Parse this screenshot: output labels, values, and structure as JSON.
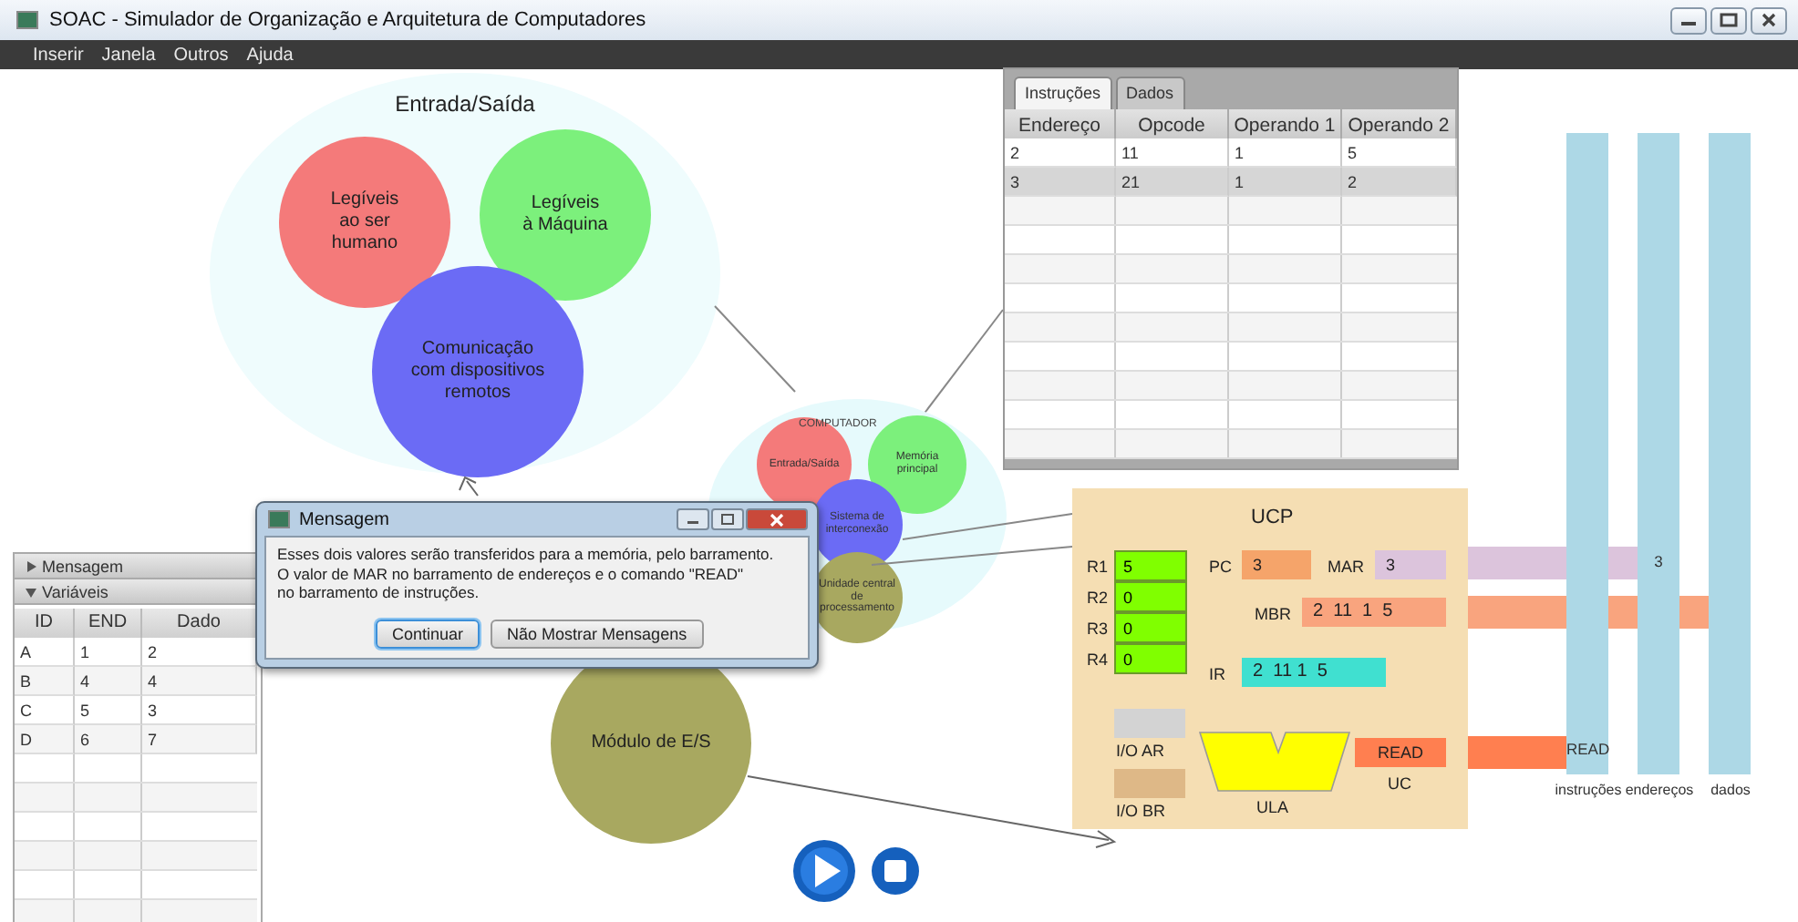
{
  "window": {
    "title": "SOAC - Simulador de Organização e Arquitetura de Computadores"
  },
  "menu": [
    {
      "label": "Inserir"
    },
    {
      "label": "Janela"
    },
    {
      "label": "Outros"
    },
    {
      "label": "Ajuda"
    }
  ],
  "io_diagram": {
    "title": "Entrada/Saída",
    "items": [
      {
        "label": "Legíveis\nao ser\nhumano",
        "color": "#f47a7a"
      },
      {
        "label": "Legíveis\nà Máquina",
        "color": "#7cf07c"
      },
      {
        "label": "Comunicação\ncom dispositivos\nremotos",
        "color": "#6b6bf5"
      }
    ]
  },
  "overview": {
    "title": "COMPUTADOR",
    "items": [
      {
        "label": "Entrada/Saída",
        "color": "#f47a7a"
      },
      {
        "label": "Memória principal",
        "color": "#7cf07c"
      },
      {
        "label": "Sistema de interconexão",
        "color": "#6b6bf5"
      },
      {
        "label": "Unidade central de processamento",
        "color": "#a8a860"
      }
    ]
  },
  "io_module": {
    "label": "Módulo de E/S"
  },
  "instructions_panel": {
    "tabs": [
      {
        "label": "Instruções",
        "selected": true
      },
      {
        "label": "Dados",
        "selected": false
      }
    ],
    "columns": [
      "Endereço",
      "Opcode",
      "Operando 1",
      "Operando 2"
    ],
    "rows": [
      {
        "cells": [
          "2",
          "11",
          "1",
          "5"
        ],
        "selected": false
      },
      {
        "cells": [
          "3",
          "21",
          "1",
          "2"
        ],
        "selected": true
      }
    ]
  },
  "cpu": {
    "title": "UCP",
    "registers": [
      {
        "name": "R1",
        "value": "5"
      },
      {
        "name": "R2",
        "value": "0"
      },
      {
        "name": "R3",
        "value": "0"
      },
      {
        "name": "R4",
        "value": "0"
      }
    ],
    "pc": {
      "label": "PC",
      "value": "3"
    },
    "mar": {
      "label": "MAR",
      "value": "3"
    },
    "mbr": {
      "label": "MBR",
      "value": "2  11  1  5"
    },
    "ir": {
      "label": "IR",
      "value": "2  11 1  5"
    },
    "io_ar": "I/O AR",
    "io_br": "I/O BR",
    "alu": "ULA",
    "uc": {
      "label": "UC",
      "value": "READ"
    }
  },
  "buses": [
    {
      "label": "instruções",
      "signal": "READ"
    },
    {
      "label": "endereços",
      "signal": "3"
    },
    {
      "label": "dados"
    }
  ],
  "dialog": {
    "title": "Mensagem",
    "message": "Esses dois valores serão transferidos para a memória, pelo barramento.\nO valor de MAR no barramento de endereços e o comando \"READ\"\nno barramento de instruções.",
    "buttons": [
      {
        "label": "Continuar",
        "focused": true
      },
      {
        "label": "Não Mostrar Mensagens",
        "focused": false
      }
    ]
  },
  "side_panel": {
    "sections": [
      {
        "label": "Mensagem",
        "expanded": false
      },
      {
        "label": "Variáveis",
        "expanded": true
      }
    ],
    "columns": [
      "ID",
      "END",
      "Dado"
    ],
    "rows": [
      [
        "A",
        "1",
        "2"
      ],
      [
        "B",
        "4",
        "4"
      ],
      [
        "C",
        "5",
        "3"
      ],
      [
        "D",
        "6",
        "7"
      ]
    ]
  }
}
